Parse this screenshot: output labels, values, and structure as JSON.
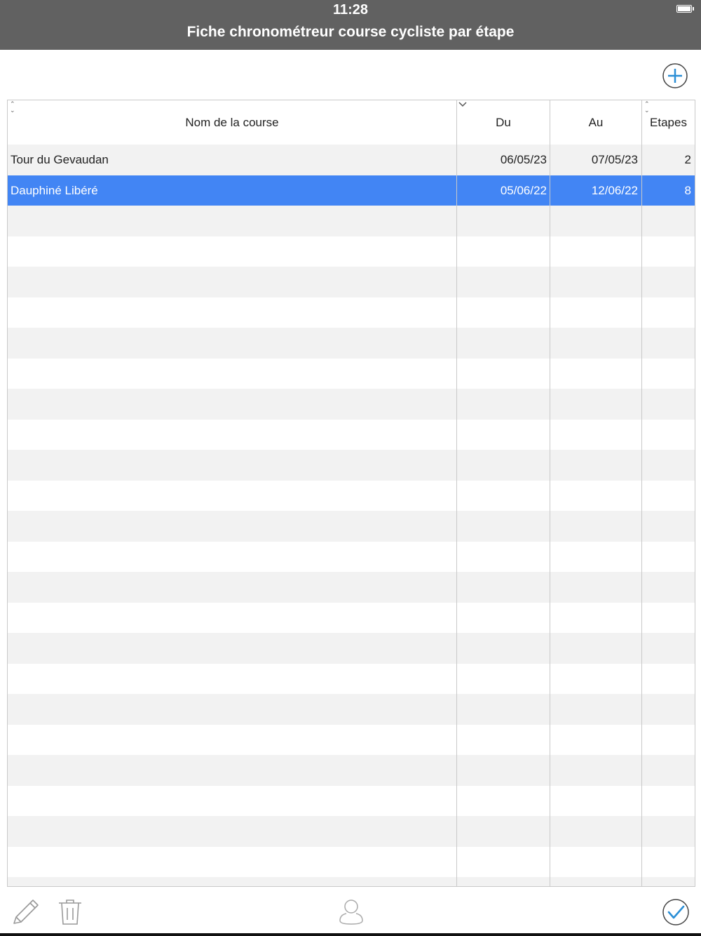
{
  "status_bar": {
    "time": "11:28"
  },
  "header": {
    "title": "Fiche chronométreur course cycliste par étape"
  },
  "table": {
    "columns": [
      {
        "key": "nom",
        "label": "Nom de la course"
      },
      {
        "key": "du",
        "label": "Du"
      },
      {
        "key": "au",
        "label": "Au"
      },
      {
        "key": "etapes",
        "label": "Etapes"
      }
    ],
    "rows": [
      {
        "nom": "Tour du Gevaudan",
        "du": "06/05/23",
        "au": "07/05/23",
        "etapes": "2",
        "selected": false
      },
      {
        "nom": "Dauphiné Libéré",
        "du": "05/06/22",
        "au": "12/06/22",
        "etapes": "8",
        "selected": true
      }
    ],
    "selected_color": "#4285f4",
    "stripe_color": "#f2f2f2"
  },
  "toolbar": {
    "icons": [
      "add-icon",
      "pencil-icon",
      "trash-icon",
      "user-icon",
      "checkmark-icon"
    ],
    "accent": "#2b8fd6"
  }
}
